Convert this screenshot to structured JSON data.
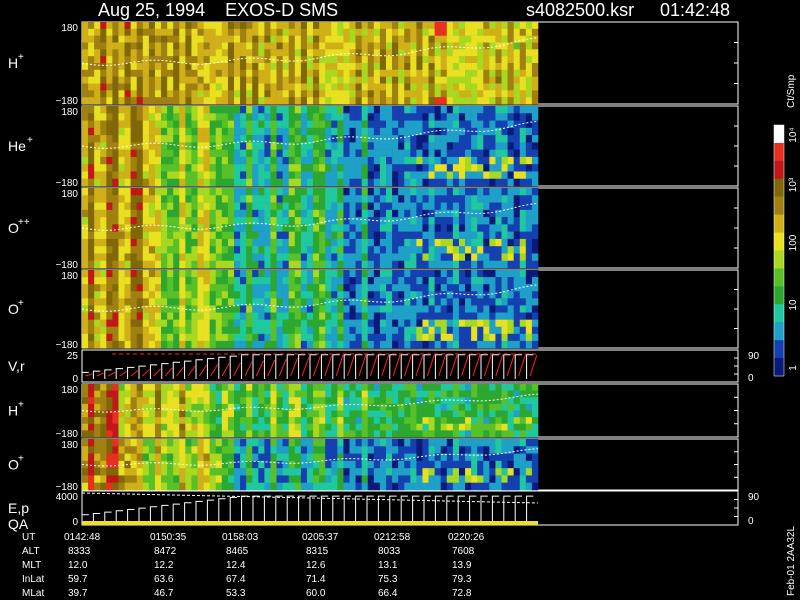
{
  "header": {
    "title": "Aug 25, 1994    EXOS-D SMS",
    "file": "s4082500.ksr",
    "time": "01:42:48"
  },
  "chart_data": {
    "type": "heatmap",
    "x_axis": {
      "times": [
        "0142:48",
        "0150:35",
        "0158:03",
        "0205:37",
        "0212:58",
        "0220:26"
      ]
    },
    "panels": [
      {
        "id": "H+",
        "label": "H",
        "sup": "+",
        "ylim": [
          -180,
          180
        ],
        "ticks": [
          "180",
          "−180"
        ],
        "kind": "spectrogram",
        "profile": "h"
      },
      {
        "id": "He+",
        "label": "He",
        "sup": "+",
        "ylim": [
          -180,
          180
        ],
        "ticks": [
          "180",
          "−180"
        ],
        "kind": "spectrogram",
        "profile": "he"
      },
      {
        "id": "O++",
        "label": "O",
        "sup": "++",
        "ylim": [
          -180,
          180
        ],
        "ticks": [
          "180",
          "−180"
        ],
        "kind": "spectrogram",
        "profile": "opp"
      },
      {
        "id": "O+",
        "label": "O",
        "sup": "+",
        "ylim": [
          -180,
          180
        ],
        "ticks": [
          "180",
          "−180"
        ],
        "kind": "spectrogram",
        "profile": "op"
      },
      {
        "id": "V,r",
        "label": "V,r",
        "sup": "",
        "ylim": [
          0,
          25
        ],
        "ticks": [
          "25",
          "0"
        ],
        "right_ticks": [
          "90",
          "0"
        ],
        "kind": "line"
      },
      {
        "id": "H+2",
        "label": "H",
        "sup": "+",
        "ylim": [
          -180,
          180
        ],
        "ticks": [
          "180",
          "−180"
        ],
        "kind": "spectrogram",
        "profile": "h2"
      },
      {
        "id": "O+2",
        "label": "O",
        "sup": "+",
        "ylim": [
          -180,
          180
        ],
        "ticks": [
          "180",
          "−180"
        ],
        "kind": "spectrogram",
        "profile": "o2"
      },
      {
        "id": "E,p",
        "label": "E,p",
        "label2": "QA",
        "sup": "",
        "ylim": [
          0,
          4000
        ],
        "ticks": [
          "4000",
          "0"
        ],
        "right_ticks": [
          "90",
          "0"
        ],
        "kind": "line"
      }
    ],
    "colorbar": {
      "unit": "Ct/Smp",
      "scale": "log",
      "range": [
        1,
        10000
      ],
      "labels": [
        "10⁴",
        "10³",
        "100",
        "10",
        "1"
      ],
      "colors": [
        "#0a1a7a",
        "#1540b0",
        "#1ea0c8",
        "#20c8a0",
        "#2ca830",
        "#58c028",
        "#a8d820",
        "#e8e020",
        "#d0b018",
        "#a08010",
        "#806808",
        "#c01818",
        "#e83020",
        "#ffffff"
      ]
    },
    "ephemeris": {
      "rows": [
        {
          "name": "UT",
          "values": [
            "0142:48",
            "0150:35",
            "0158:03",
            "0205:37",
            "0212:58",
            "0220:26"
          ]
        },
        {
          "name": "ALT",
          "values": [
            "8333",
            "8472",
            "8465",
            "8315",
            "8033",
            "7608"
          ]
        },
        {
          "name": "MLT",
          "values": [
            "12.0",
            "12.2",
            "12.4",
            "12.6",
            "13.1",
            "13.9"
          ]
        },
        {
          "name": "InLat",
          "values": [
            "59.7",
            "63.6",
            "67.4",
            "71.4",
            "75.3",
            "79.3"
          ]
        },
        {
          "name": "MLat",
          "values": [
            "39.7",
            "46.7",
            "53.3",
            "60.0",
            "66.4",
            "72.8"
          ]
        }
      ]
    },
    "stamp": "Feb-01 2AA32L"
  }
}
